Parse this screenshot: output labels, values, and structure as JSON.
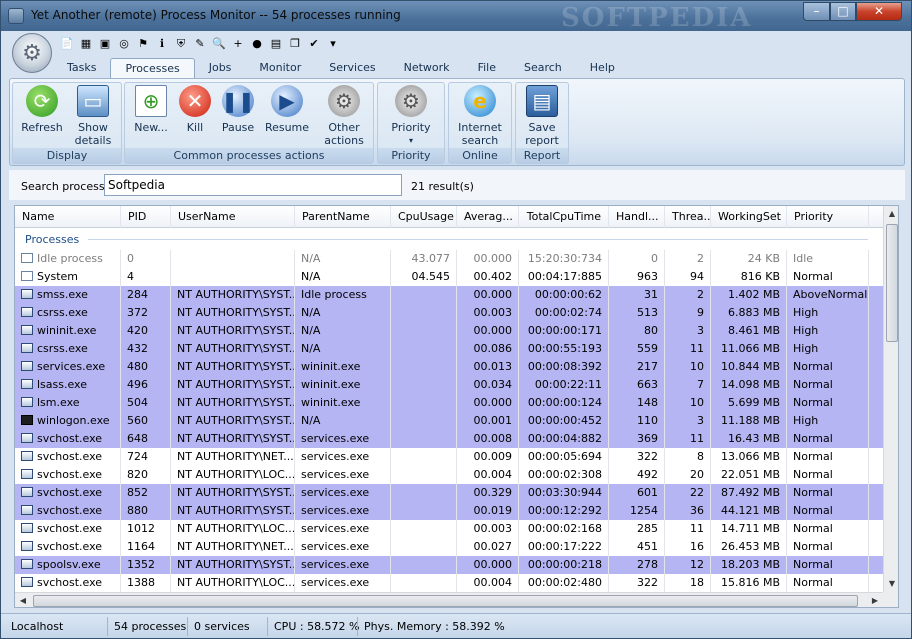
{
  "window": {
    "title": "Yet Another (remote) Process Monitor -- 54 processes running",
    "watermark": "SOFTPEDIA",
    "controls": {
      "minimize": "–",
      "maximize": "□",
      "close": "✕"
    }
  },
  "quick_access": [
    {
      "icon": "document-icon",
      "glyph": "📄"
    },
    {
      "icon": "memory-icon",
      "glyph": "▦"
    },
    {
      "icon": "monitor-icon",
      "glyph": "▣"
    },
    {
      "icon": "target-icon",
      "glyph": "◎"
    },
    {
      "icon": "network-icon",
      "glyph": "⚑"
    },
    {
      "icon": "info-icon",
      "glyph": "ℹ"
    },
    {
      "icon": "shield-icon",
      "glyph": "⛨"
    },
    {
      "icon": "edit-icon",
      "glyph": "✎"
    },
    {
      "icon": "search-doc-icon",
      "glyph": "🔍"
    },
    {
      "icon": "add-icon",
      "glyph": "+"
    },
    {
      "icon": "globe-icon",
      "glyph": "●"
    },
    {
      "icon": "save-icon",
      "glyph": "▤"
    },
    {
      "icon": "copy-icon",
      "glyph": "❐"
    },
    {
      "icon": "check-icon",
      "glyph": "✔"
    },
    {
      "icon": "dropdown-icon",
      "glyph": "▾"
    }
  ],
  "tabs": [
    "Tasks",
    "Processes",
    "Jobs",
    "Monitor",
    "Services",
    "Network",
    "File",
    "Search",
    "Help"
  ],
  "active_tab": "Processes",
  "ribbon": {
    "groups": {
      "display": "Display",
      "common": "Common processes actions",
      "priority": "Priority",
      "online": "Online",
      "report": "Report"
    },
    "buttons": {
      "refresh": "Refresh",
      "show_details": "Show details",
      "new": "New...",
      "kill": "Kill",
      "pause": "Pause",
      "resume": "Resume",
      "other_actions": "Other actions",
      "priority": "Priority",
      "internet_search": "Internet search",
      "save_report": "Save report"
    }
  },
  "search": {
    "label": "Search process",
    "value": "Softpedia",
    "results": "21 result(s)"
  },
  "table": {
    "columns": [
      "Name",
      "PID",
      "UserName",
      "ParentName",
      "CpuUsage",
      "Averag...",
      "TotalCpuTime",
      "Handl...",
      "Threa...",
      "WorkingSet",
      "Priority"
    ],
    "group_label": "Processes",
    "rows": [
      {
        "name": "Idle process",
        "pid": "0",
        "user": "",
        "parent": "N/A",
        "cpu": "43.077",
        "avg": "00.000",
        "total": "15:20:30:734",
        "handles": "0",
        "threads": "2",
        "ws": "24 KB",
        "priority": "Idle",
        "hl": false,
        "grey": true,
        "icon": "sys"
      },
      {
        "name": "System",
        "pid": "4",
        "user": "",
        "parent": "N/A",
        "cpu": "04.545",
        "avg": "00.402",
        "total": "00:04:17:885",
        "handles": "963",
        "threads": "94",
        "ws": "816 KB",
        "priority": "Normal",
        "hl": false,
        "grey": false,
        "icon": "sys"
      },
      {
        "name": "smss.exe",
        "pid": "284",
        "user": "NT AUTHORITY\\SYST...",
        "parent": "Idle process",
        "cpu": "",
        "avg": "00.000",
        "total": "00:00:00:62",
        "handles": "31",
        "threads": "2",
        "ws": "1.402 MB",
        "priority": "AboveNormal",
        "hl": true,
        "grey": false,
        "icon": "app"
      },
      {
        "name": "csrss.exe",
        "pid": "372",
        "user": "NT AUTHORITY\\SYST...",
        "parent": "N/A",
        "cpu": "",
        "avg": "00.003",
        "total": "00:00:02:74",
        "handles": "513",
        "threads": "9",
        "ws": "6.883 MB",
        "priority": "High",
        "hl": true,
        "grey": false,
        "icon": "app"
      },
      {
        "name": "wininit.exe",
        "pid": "420",
        "user": "NT AUTHORITY\\SYST...",
        "parent": "N/A",
        "cpu": "",
        "avg": "00.000",
        "total": "00:00:00:171",
        "handles": "80",
        "threads": "3",
        "ws": "8.461 MB",
        "priority": "High",
        "hl": true,
        "grey": false,
        "icon": "app"
      },
      {
        "name": "csrss.exe",
        "pid": "432",
        "user": "NT AUTHORITY\\SYST...",
        "parent": "N/A",
        "cpu": "",
        "avg": "00.086",
        "total": "00:00:55:193",
        "handles": "559",
        "threads": "11",
        "ws": "11.066 MB",
        "priority": "High",
        "hl": true,
        "grey": false,
        "icon": "app"
      },
      {
        "name": "services.exe",
        "pid": "480",
        "user": "NT AUTHORITY\\SYST...",
        "parent": "wininit.exe",
        "cpu": "",
        "avg": "00.013",
        "total": "00:00:08:392",
        "handles": "217",
        "threads": "10",
        "ws": "10.844 MB",
        "priority": "Normal",
        "hl": true,
        "grey": false,
        "icon": "app"
      },
      {
        "name": "lsass.exe",
        "pid": "496",
        "user": "NT AUTHORITY\\SYST...",
        "parent": "wininit.exe",
        "cpu": "",
        "avg": "00.034",
        "total": "00:00:22:11",
        "handles": "663",
        "threads": "7",
        "ws": "14.098 MB",
        "priority": "Normal",
        "hl": true,
        "grey": false,
        "icon": "app"
      },
      {
        "name": "lsm.exe",
        "pid": "504",
        "user": "NT AUTHORITY\\SYST...",
        "parent": "wininit.exe",
        "cpu": "",
        "avg": "00.000",
        "total": "00:00:00:124",
        "handles": "148",
        "threads": "10",
        "ws": "5.699 MB",
        "priority": "Normal",
        "hl": true,
        "grey": false,
        "icon": "app"
      },
      {
        "name": "winlogon.exe",
        "pid": "560",
        "user": "NT AUTHORITY\\SYST...",
        "parent": "N/A",
        "cpu": "",
        "avg": "00.001",
        "total": "00:00:00:452",
        "handles": "110",
        "threads": "3",
        "ws": "11.188 MB",
        "priority": "High",
        "hl": true,
        "grey": false,
        "icon": "win"
      },
      {
        "name": "svchost.exe",
        "pid": "648",
        "user": "NT AUTHORITY\\SYST...",
        "parent": "services.exe",
        "cpu": "",
        "avg": "00.008",
        "total": "00:00:04:882",
        "handles": "369",
        "threads": "11",
        "ws": "16.43 MB",
        "priority": "Normal",
        "hl": true,
        "grey": false,
        "icon": "app"
      },
      {
        "name": "svchost.exe",
        "pid": "724",
        "user": "NT AUTHORITY\\NET...",
        "parent": "services.exe",
        "cpu": "",
        "avg": "00.009",
        "total": "00:00:05:694",
        "handles": "322",
        "threads": "8",
        "ws": "13.066 MB",
        "priority": "Normal",
        "hl": false,
        "grey": false,
        "icon": "app"
      },
      {
        "name": "svchost.exe",
        "pid": "820",
        "user": "NT AUTHORITY\\LOC...",
        "parent": "services.exe",
        "cpu": "",
        "avg": "00.004",
        "total": "00:00:02:308",
        "handles": "492",
        "threads": "20",
        "ws": "22.051 MB",
        "priority": "Normal",
        "hl": false,
        "grey": false,
        "icon": "app"
      },
      {
        "name": "svchost.exe",
        "pid": "852",
        "user": "NT AUTHORITY\\SYST...",
        "parent": "services.exe",
        "cpu": "",
        "avg": "00.329",
        "total": "00:03:30:944",
        "handles": "601",
        "threads": "22",
        "ws": "87.492 MB",
        "priority": "Normal",
        "hl": true,
        "grey": false,
        "icon": "app"
      },
      {
        "name": "svchost.exe",
        "pid": "880",
        "user": "NT AUTHORITY\\SYST...",
        "parent": "services.exe",
        "cpu": "",
        "avg": "00.019",
        "total": "00:00:12:292",
        "handles": "1254",
        "threads": "36",
        "ws": "44.121 MB",
        "priority": "Normal",
        "hl": true,
        "grey": false,
        "icon": "app"
      },
      {
        "name": "svchost.exe",
        "pid": "1012",
        "user": "NT AUTHORITY\\LOC...",
        "parent": "services.exe",
        "cpu": "",
        "avg": "00.003",
        "total": "00:00:02:168",
        "handles": "285",
        "threads": "11",
        "ws": "14.711 MB",
        "priority": "Normal",
        "hl": false,
        "grey": false,
        "icon": "app"
      },
      {
        "name": "svchost.exe",
        "pid": "1164",
        "user": "NT AUTHORITY\\NET...",
        "parent": "services.exe",
        "cpu": "",
        "avg": "00.027",
        "total": "00:00:17:222",
        "handles": "451",
        "threads": "16",
        "ws": "26.453 MB",
        "priority": "Normal",
        "hl": false,
        "grey": false,
        "icon": "app"
      },
      {
        "name": "spoolsv.exe",
        "pid": "1352",
        "user": "NT AUTHORITY\\SYST...",
        "parent": "services.exe",
        "cpu": "",
        "avg": "00.000",
        "total": "00:00:00:218",
        "handles": "278",
        "threads": "12",
        "ws": "18.203 MB",
        "priority": "Normal",
        "hl": true,
        "grey": false,
        "icon": "app"
      },
      {
        "name": "svchost.exe",
        "pid": "1388",
        "user": "NT AUTHORITY\\LOC...",
        "parent": "services.exe",
        "cpu": "",
        "avg": "00.004",
        "total": "00:00:02:480",
        "handles": "322",
        "threads": "18",
        "ws": "15.816 MB",
        "priority": "Normal",
        "hl": false,
        "grey": false,
        "icon": "app"
      }
    ]
  },
  "status": {
    "host": "Localhost",
    "processes": "54 processes",
    "services": "0 services",
    "cpu": "CPU : 58.572 %",
    "memory": "Phys. Memory : 58.392 %"
  },
  "colors": {
    "highlight_row": "#b5b5f3",
    "titlebar": "#4d739c",
    "ribbon": "#dde8f4"
  }
}
